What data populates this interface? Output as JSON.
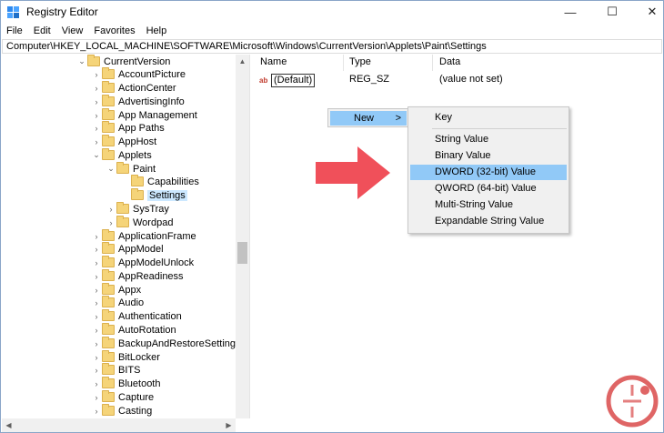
{
  "window": {
    "title": "Registry Editor",
    "minimize_glyph": "—",
    "maximize_glyph": "☐",
    "close_glyph": "✕"
  },
  "menu": [
    "File",
    "Edit",
    "View",
    "Favorites",
    "Help"
  ],
  "address": "Computer\\HKEY_LOCAL_MACHINE\\SOFTWARE\\Microsoft\\Windows\\CurrentVersion\\Applets\\Paint\\Settings",
  "tree": {
    "current_version": "CurrentVersion",
    "items": [
      "AccountPicture",
      "ActionCenter",
      "AdvertisingInfo",
      "App Management",
      "App Paths",
      "AppHost",
      "Applets",
      "Paint",
      "Capabilities",
      "Settings",
      "SysTray",
      "Wordpad",
      "ApplicationFrame",
      "AppModel",
      "AppModelUnlock",
      "AppReadiness",
      "Appx",
      "Audio",
      "Authentication",
      "AutoRotation",
      "BackupAndRestoreSettings",
      "BitLocker",
      "BITS",
      "Bluetooth",
      "Capture",
      "Casting"
    ]
  },
  "list": {
    "columns": [
      "Name",
      "Type",
      "Data"
    ],
    "row": {
      "name": "(Default)",
      "type": "REG_SZ",
      "data": "(value not set)",
      "icon": "ab"
    }
  },
  "context_menu": {
    "new_label": "New",
    "new_arrow": ">",
    "submenu": [
      "Key",
      "String Value",
      "Binary Value",
      "DWORD (32-bit) Value",
      "QWORD (64-bit) Value",
      "Multi-String Value",
      "Expandable String Value"
    ],
    "highlighted": "DWORD (32-bit) Value"
  },
  "colors": {
    "highlight": "#91c9f7",
    "selection": "#cce8ff",
    "arrow": "#f0505a",
    "watermark": "#d94a4a"
  }
}
